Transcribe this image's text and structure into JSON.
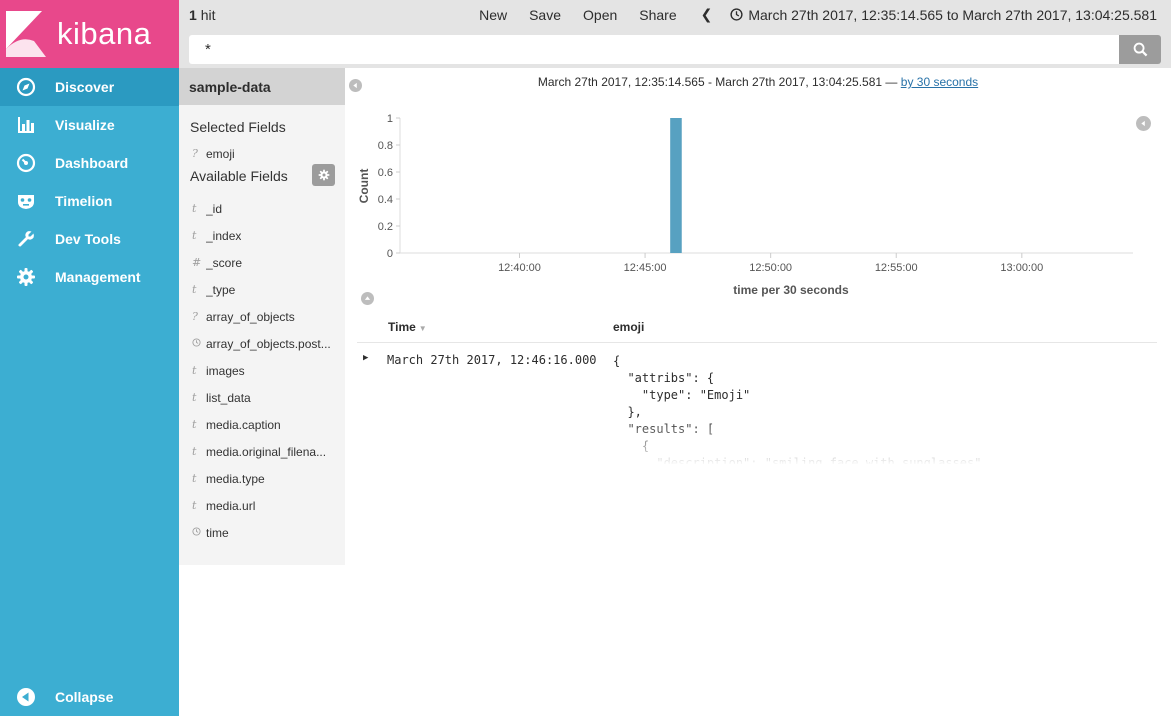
{
  "app": {
    "name": "kibana",
    "brand_color": "#e8488b",
    "nav_color": "#3caed2",
    "nav_active_color": "#2b9ac1"
  },
  "sidebar": {
    "items": [
      {
        "label": "Discover",
        "icon": "compass-icon",
        "active": true
      },
      {
        "label": "Visualize",
        "icon": "bar-chart-icon",
        "active": false
      },
      {
        "label": "Dashboard",
        "icon": "dashboard-gauge-icon",
        "active": false
      },
      {
        "label": "Timelion",
        "icon": "timelion-mask-icon",
        "active": false
      },
      {
        "label": "Dev Tools",
        "icon": "wrench-icon",
        "active": false
      },
      {
        "label": "Management",
        "icon": "gear-icon",
        "active": false
      }
    ],
    "collapse_label": "Collapse"
  },
  "topbar": {
    "hit_count": "1",
    "hit_label": "hit",
    "menu": [
      "New",
      "Save",
      "Open",
      "Share"
    ],
    "time_range": "March 27th 2017, 12:35:14.565 to March 27th 2017, 13:04:25.581"
  },
  "search": {
    "value": "*"
  },
  "fields": {
    "index_pattern": "sample-data",
    "selected_heading": "Selected Fields",
    "available_heading": "Available Fields",
    "selected": [
      {
        "type": "?",
        "name": "emoji"
      }
    ],
    "available": [
      {
        "type": "t",
        "name": "_id"
      },
      {
        "type": "t",
        "name": "_index"
      },
      {
        "type": "#",
        "name": "_score"
      },
      {
        "type": "t",
        "name": "_type"
      },
      {
        "type": "?",
        "name": "array_of_objects"
      },
      {
        "type": "clock",
        "name": "array_of_objects.post..."
      },
      {
        "type": "t",
        "name": "images"
      },
      {
        "type": "t",
        "name": "list_data"
      },
      {
        "type": "t",
        "name": "media.caption"
      },
      {
        "type": "t",
        "name": "media.original_filena..."
      },
      {
        "type": "t",
        "name": "media.type"
      },
      {
        "type": "t",
        "name": "media.url"
      },
      {
        "type": "clock",
        "name": "time"
      }
    ]
  },
  "histogram": {
    "range_text": "March 27th 2017, 12:35:14.565 - March 27th 2017, 13:04:25.581 —",
    "interval_link": "by 30 seconds"
  },
  "chart_data": {
    "type": "bar",
    "ylabel": "Count",
    "xlabel": "time per 30 seconds",
    "ylim": [
      0,
      1
    ],
    "yticks": [
      0,
      0.2,
      0.4,
      0.6,
      0.8,
      1
    ],
    "yticklabels": [
      "0",
      "0.2",
      "0.4",
      "0.6",
      "0.8",
      "1"
    ],
    "xlim": [
      "12:35:14.565",
      "13:04:25.581"
    ],
    "xticks": [
      "12:40:00",
      "12:45:00",
      "12:50:00",
      "12:55:00",
      "13:00:00"
    ],
    "bar_color": "#57a1c1",
    "bars": [
      {
        "start": "12:46:00",
        "end": "12:46:30",
        "value": 1
      }
    ],
    "grid": false
  },
  "doc_table": {
    "columns": [
      "Time",
      "emoji"
    ],
    "rows": [
      {
        "time": "March 27th 2017, 12:46:16.000",
        "source_lines": [
          "{",
          "  \"attribs\": {",
          "    \"type\": \"Emoji\"",
          "  },",
          "  \"results\": [",
          "    {",
          "      \"description\": \"smiling face with sunglasses\","
        ]
      }
    ]
  }
}
